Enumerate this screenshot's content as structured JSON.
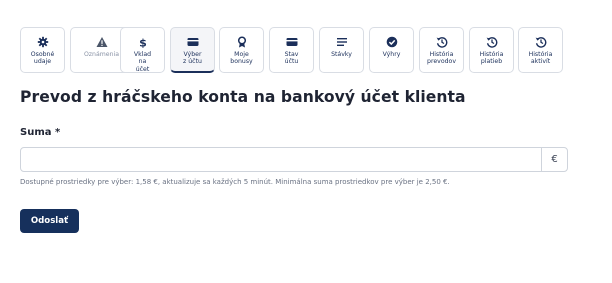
{
  "tabs": [
    {
      "label": "Osobné\nudaje",
      "icon": "gear-icon"
    },
    {
      "label": "Oznámenia",
      "icon": "warning-icon"
    },
    {
      "label": "Vklad\nna\núčet",
      "icon": "dollar-icon"
    },
    {
      "label": "Výber\nz účtu",
      "icon": "card-icon"
    },
    {
      "label": "Moje\nbonusy",
      "icon": "medal-icon"
    },
    {
      "label": "Stav\núčtu",
      "icon": "card-icon"
    },
    {
      "label": "Stávky",
      "icon": "list-icon"
    },
    {
      "label": "Výhry",
      "icon": "check-circle-icon"
    },
    {
      "label": "História\nprevodov",
      "icon": "history-icon"
    },
    {
      "label": "História\nplatieb",
      "icon": "history-icon"
    },
    {
      "label": "História\naktivít",
      "icon": "history-icon"
    }
  ],
  "page": {
    "title": "Prevod z hráčskeho konta na bankový účet klienta"
  },
  "form": {
    "amount_label": "Suma *",
    "amount_value": "",
    "currency_suffix": "€",
    "hint": "Dostupné prostriedky pre výber: 1,58 €, aktualizuje sa každých 5 minút. Minimálna suma prostriedkov pre výber je 2,50 €.",
    "submit_label": "Odoslať"
  },
  "colors": {
    "primary": "#16305c",
    "muted_text": "#8a93a6",
    "border": "#d9dde4"
  }
}
